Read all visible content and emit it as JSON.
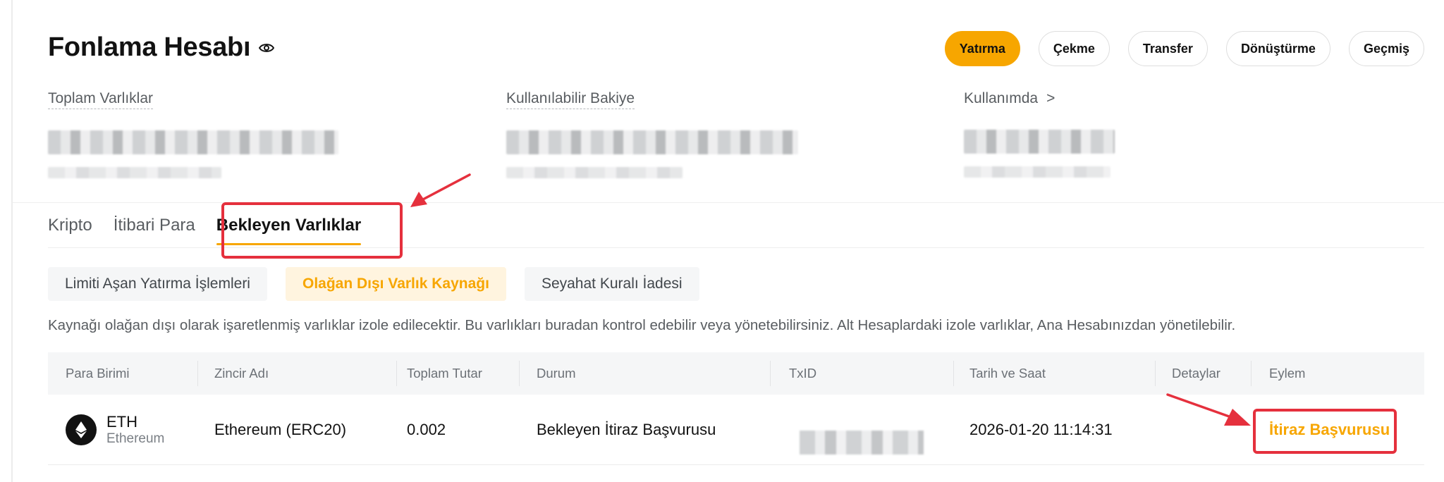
{
  "header": {
    "title": "Fonlama Hesabı",
    "actions": [
      "Yatırma",
      "Çekme",
      "Transfer",
      "Dönüştürme",
      "Geçmiş"
    ]
  },
  "balances": {
    "total_label": "Toplam Varlıklar",
    "available_label": "Kullanılabilir Bakiye",
    "in_use_label": "Kullanımda",
    "in_use_chevron": ">"
  },
  "tabs": [
    "Kripto",
    "İtibari Para",
    "Bekleyen Varlıklar"
  ],
  "active_tab": "Bekleyen Varlıklar",
  "filters": [
    "Limiti Aşan Yatırma İşlemleri",
    "Olağan Dışı Varlık Kaynağı",
    "Seyahat Kuralı İadesi"
  ],
  "active_filter": "Olağan Dışı Varlık Kaynağı",
  "notice": "Kaynağı olağan dışı olarak işaretlenmiş varlıklar izole edilecektir. Bu varlıkları buradan kontrol edebilir veya yönetebilirsiniz. Alt Hesaplardaki izole varlıklar, Ana Hesabınızdan yönetilebilir.",
  "table": {
    "columns": [
      "Para Birimi",
      "Zincir Adı",
      "Toplam Tutar",
      "Durum",
      "TxID",
      "Tarih ve Saat",
      "Detaylar",
      "Eylem"
    ],
    "rows": [
      {
        "currency_symbol": "ETH",
        "currency_name": "Ethereum",
        "chain": "Ethereum (ERC20)",
        "amount": "0.002",
        "status": "Bekleyen İtiraz Başvurusu",
        "datetime": "2026-01-20 11:14:31",
        "action": "İtiraz Başvurusu"
      }
    ]
  },
  "colors": {
    "accent": "#f7a600",
    "annotation": "#e5303d"
  }
}
